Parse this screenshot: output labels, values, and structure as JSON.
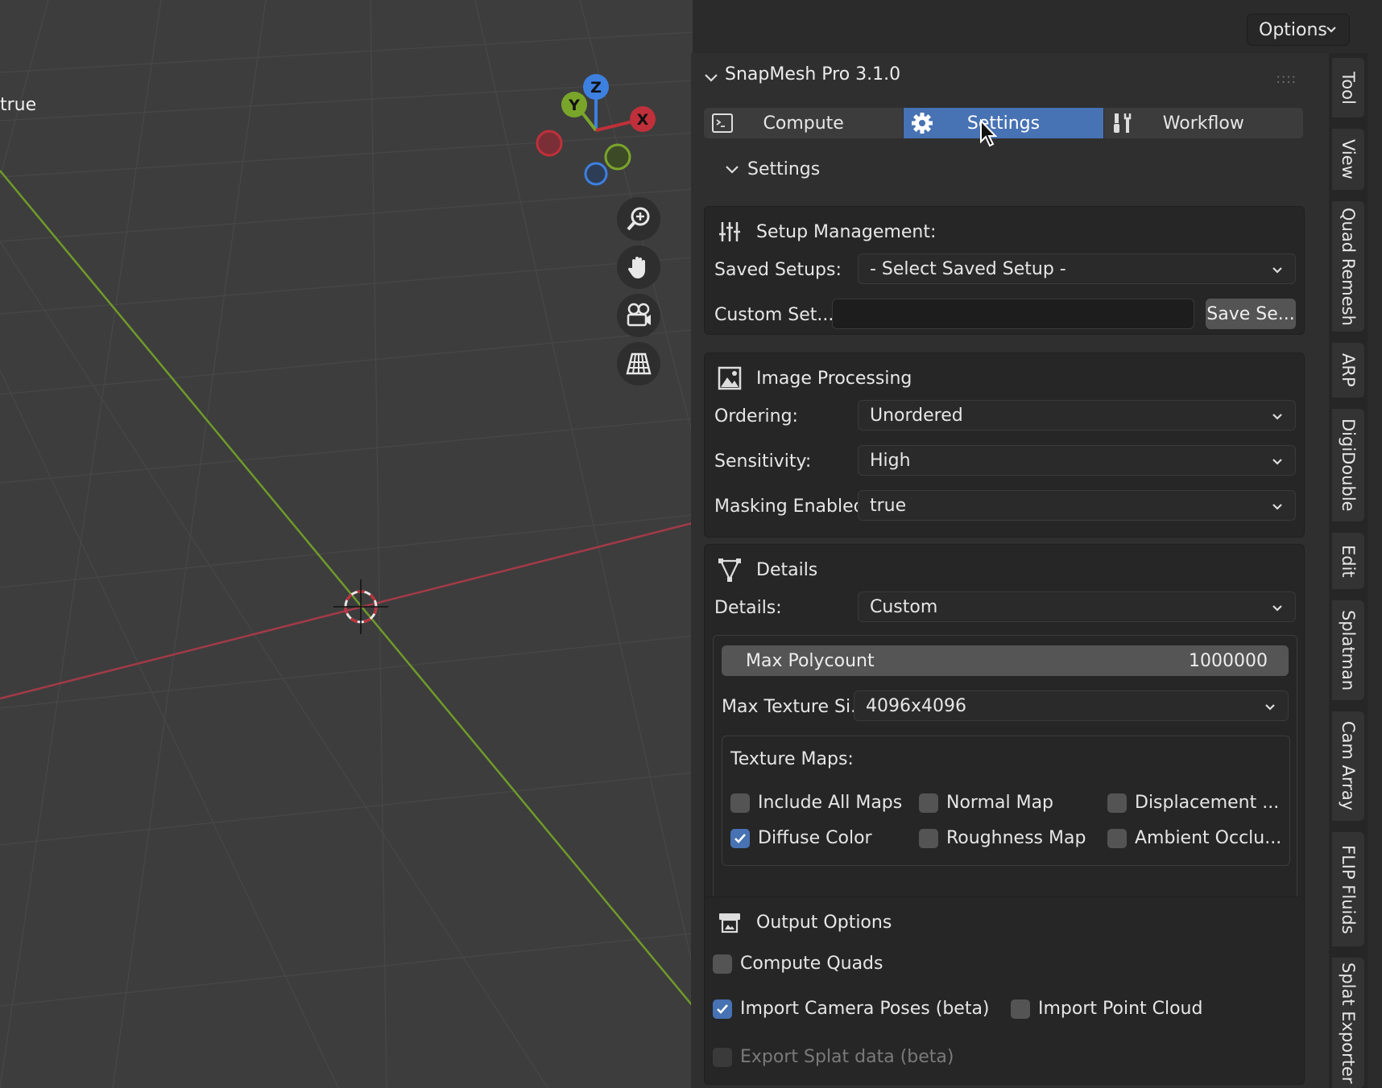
{
  "viewport": {
    "overlay_text": "true",
    "gizmo": {
      "z": "Z",
      "y": "Y",
      "x": "X"
    }
  },
  "header": {
    "options_label": "Options"
  },
  "panel": {
    "title": "SnapMesh Pro 3.1.0",
    "tabs": [
      {
        "label": "Compute",
        "icon": "terminal-icon"
      },
      {
        "label": "Settings",
        "icon": "gear-icon"
      },
      {
        "label": "Workflow",
        "icon": "tools-icon"
      }
    ],
    "active_tab": "Settings",
    "settings_section_label": "Settings",
    "setup_management": {
      "title": "Setup Management:",
      "saved_setups_label": "Saved Setups:",
      "saved_setups_value": "- Select Saved Setup -",
      "custom_setup_label": "Custom Set...",
      "custom_setup_value": "",
      "save_button": "Save Se..."
    },
    "image_processing": {
      "title": "Image Processing",
      "ordering_label": "Ordering:",
      "ordering_value": "Unordered",
      "sensitivity_label": "Sensitivity:",
      "sensitivity_value": "High",
      "masking_label": "Masking Enabled:",
      "masking_value": "true"
    },
    "details": {
      "title": "Details",
      "details_label": "Details:",
      "details_value": "Custom",
      "max_polycount_label": "Max Polycount",
      "max_polycount_value": "1000000",
      "max_texture_label": "Max Texture Si...",
      "max_texture_value": "4096x4096",
      "texture_maps_label": "Texture Maps:",
      "maps": [
        {
          "label": "Include All Maps",
          "checked": false
        },
        {
          "label": "Normal Map",
          "checked": false
        },
        {
          "label": "Displacement ...",
          "checked": false
        },
        {
          "label": "Diffuse Color",
          "checked": true
        },
        {
          "label": "Roughness Map",
          "checked": false
        },
        {
          "label": "Ambient Occlu...",
          "checked": false
        }
      ]
    },
    "output_options": {
      "title": "Output Options",
      "compute_quads": {
        "label": "Compute Quads",
        "checked": false
      },
      "import_camera_poses": {
        "label": "Import Camera Poses (beta)",
        "checked": true
      },
      "import_point_cloud": {
        "label": "Import Point Cloud",
        "checked": false
      },
      "export_splat": {
        "label": "Export Splat data (beta)",
        "checked": false,
        "disabled": true
      }
    }
  },
  "side_tabs": [
    "Tool",
    "View",
    "Quad Remesh",
    "ARP",
    "DigiDouble",
    "Edit",
    "Splatman",
    "Cam Array",
    "FLIP Fluids",
    "Splat Exporter"
  ],
  "colors": {
    "accent": "#4772b3",
    "x_axis": "#b84050",
    "y_axis": "#7aa52b",
    "z_axis": "#3d80e0"
  }
}
